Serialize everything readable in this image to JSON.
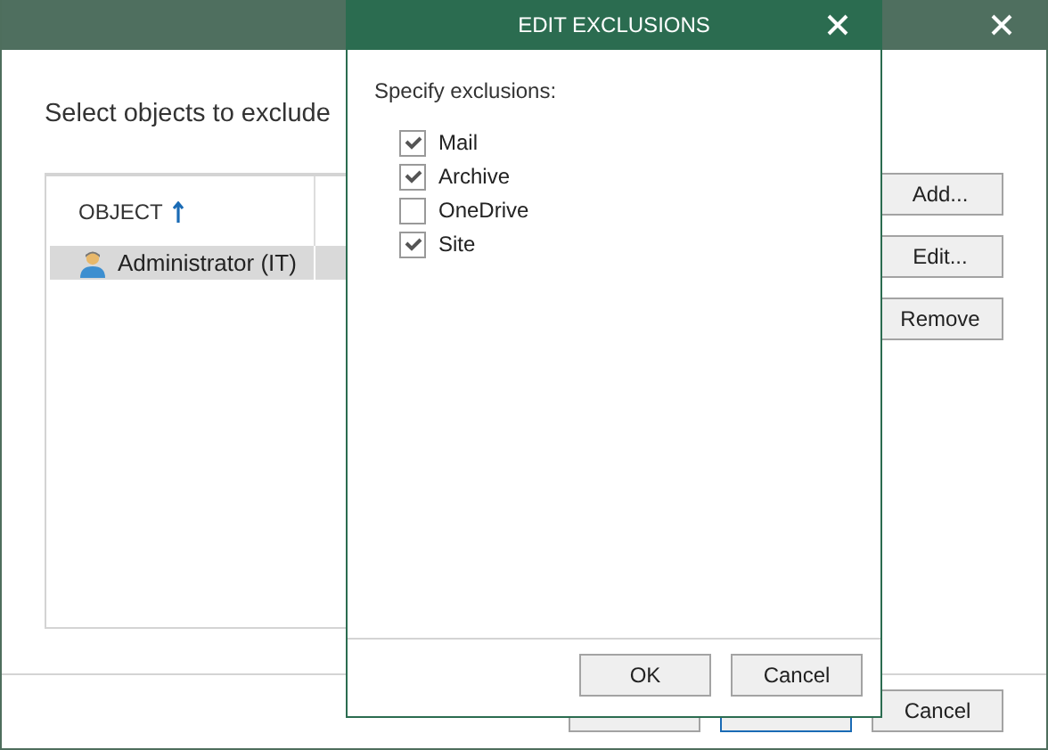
{
  "window": {
    "heading": "Select objects to exclude"
  },
  "table": {
    "columns": [
      {
        "label": "OBJECT",
        "sort_ascending": true
      }
    ],
    "rows": [
      {
        "name": "Administrator (IT)",
        "selected": true
      }
    ]
  },
  "side_buttons": [
    "Add...",
    "Edit...",
    "Remove"
  ],
  "footer_buttons": [
    {
      "focused": false
    },
    {
      "focused": true
    },
    {
      "label": "Cancel",
      "focused": false
    }
  ],
  "dialog": {
    "title": "EDIT EXCLUSIONS",
    "prompt": "Specify exclusions:",
    "options": [
      {
        "label": "Mail",
        "checked": true
      },
      {
        "label": "Archive",
        "checked": true
      },
      {
        "label": "OneDrive",
        "checked": false
      },
      {
        "label": "Site",
        "checked": true
      }
    ],
    "buttons": [
      "OK",
      "Cancel"
    ]
  }
}
